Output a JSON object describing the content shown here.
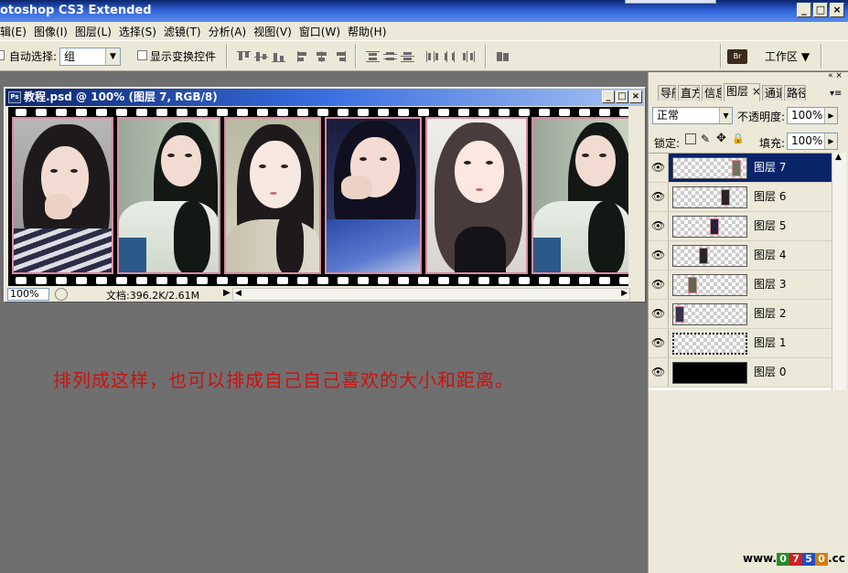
{
  "app": {
    "title": "otoshop CS3 Extended"
  },
  "menu": [
    {
      "label": "辑(E)"
    },
    {
      "label": "图像(I)"
    },
    {
      "label": "图层(L)"
    },
    {
      "label": "选择(S)"
    },
    {
      "label": "滤镜(T)"
    },
    {
      "label": "分析(A)"
    },
    {
      "label": "视图(V)"
    },
    {
      "label": "窗口(W)"
    },
    {
      "label": "帮助(H)"
    }
  ],
  "options": {
    "auto_select_label": "自动选择:",
    "auto_select_value": "组",
    "show_transform_label": "显示变换控件",
    "workspace_label": "工作区 ▼"
  },
  "document": {
    "title": "教程.psd @ 100% (图层 7, RGB/8)",
    "zoom": "100%",
    "doc_info": "文档:396.2K/2.61M"
  },
  "annotation": "排列成这样，也可以排成自己自己喜欢的大小和距离。",
  "panel": {
    "tabs": [
      {
        "label": "导航"
      },
      {
        "label": "直方"
      },
      {
        "label": "信息"
      },
      {
        "label": "图层"
      },
      {
        "label": "通道"
      },
      {
        "label": "路径"
      }
    ],
    "blend_mode": "正常",
    "opacity_label": "不透明度:",
    "opacity_value": "100%",
    "lock_label": "锁定:",
    "fill_label": "填充:",
    "fill_value": "100%",
    "layers": [
      {
        "name": "图层 7",
        "selected": true
      },
      {
        "name": "图层 6"
      },
      {
        "name": "图层 5"
      },
      {
        "name": "图层 4"
      },
      {
        "name": "图层 3"
      },
      {
        "name": "图层 2"
      },
      {
        "name": "图层 1"
      },
      {
        "name": "图层 0"
      }
    ]
  },
  "watermark": {
    "prefix": "www.",
    "d1": "0",
    "d2": "7",
    "d3": "5",
    "d4": "0",
    "suffix": ".cc"
  },
  "colors": {
    "accent": "#0a246a",
    "annotation": "#cc1111",
    "frame_border": "#d98aa0"
  }
}
